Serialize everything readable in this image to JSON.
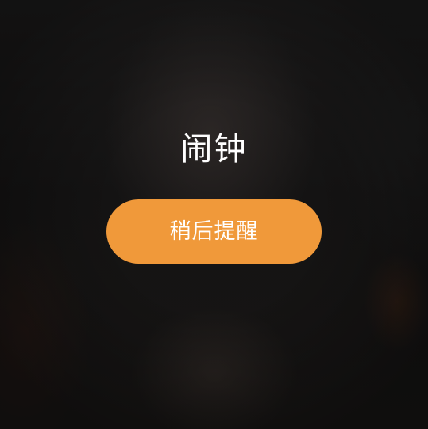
{
  "alarm": {
    "title": "闹钟",
    "snooze_label": "稍后提醒"
  },
  "colors": {
    "accent": "#f0993a",
    "text": "#ffffff",
    "background": "#151414"
  }
}
